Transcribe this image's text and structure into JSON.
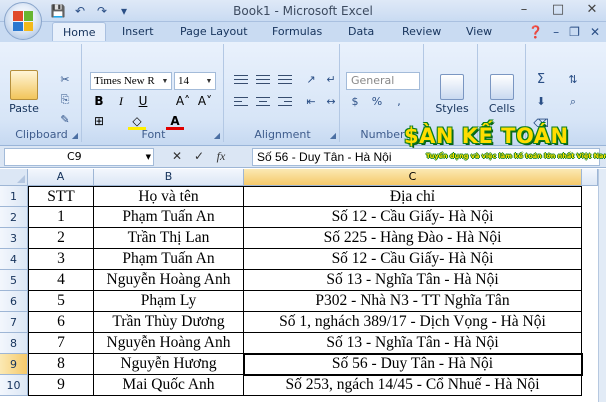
{
  "window": {
    "title": "Book1 - Microsoft Excel"
  },
  "tabs": [
    "Home",
    "Insert",
    "Page Layout",
    "Formulas",
    "Data",
    "Review",
    "View"
  ],
  "ribbon": {
    "clipboard": {
      "label": "Clipboard",
      "paste": "Paste"
    },
    "font": {
      "label": "Font",
      "name": "Times New R",
      "size": "14"
    },
    "alignment": {
      "label": "Alignment"
    },
    "number": {
      "label": "Number",
      "format": "General"
    },
    "styles": {
      "label": "Styles"
    },
    "cells": {
      "label": "Cells"
    }
  },
  "brand": {
    "name": "$ÀN KẾ TOÁN",
    "tagline": "Tuyển dụng và việc làm kế toán lớn nhất Việt Nam"
  },
  "formula_bar": {
    "name_box": "C9",
    "fx": "fx",
    "content": "Số 56 - Duy Tân - Hà Nội"
  },
  "columns": [
    "A",
    "B",
    "C"
  ],
  "rows": [
    "1",
    "2",
    "3",
    "4",
    "5",
    "6",
    "7",
    "8",
    "9",
    "10"
  ],
  "table": {
    "headers": [
      "STT",
      "Họ và tên",
      "Địa chỉ"
    ],
    "rows": [
      [
        "1",
        "Phạm Tuấn An",
        "Số 12 - Cầu Giấy- Hà Nội"
      ],
      [
        "2",
        "Trần Thị Lan",
        "Số 225 - Hàng Đào - Hà Nội"
      ],
      [
        "3",
        "Phạm Tuấn An",
        "Số 12 - Cầu Giấy- Hà Nội"
      ],
      [
        "4",
        "Nguyễn Hoàng Anh",
        "Số 13 - Nghĩa Tân - Hà Nội"
      ],
      [
        "5",
        "Phạm Ly",
        "P302 - Nhà N3 - TT Nghĩa Tân"
      ],
      [
        "6",
        "Trần Thùy Dương",
        "Số 1, nghách 389/17 - Dịch Vọng - Hà Nội"
      ],
      [
        "7",
        "Nguyễn Hoàng Anh",
        "Số 13 - Nghĩa Tân - Hà Nội"
      ],
      [
        "8",
        "Nguyễn Hương",
        "Số 56 - Duy Tân - Hà Nội"
      ],
      [
        "9",
        "Mai Quốc Anh",
        "Số 253, ngách 14/45 - Cổ Nhuế - Hà Nội"
      ]
    ]
  },
  "colors": {
    "accent": "#c9dbf2",
    "selection": "#f5c96a",
    "brand_yellow": "#ffdd00",
    "brand_green": "#0a7d1c"
  }
}
